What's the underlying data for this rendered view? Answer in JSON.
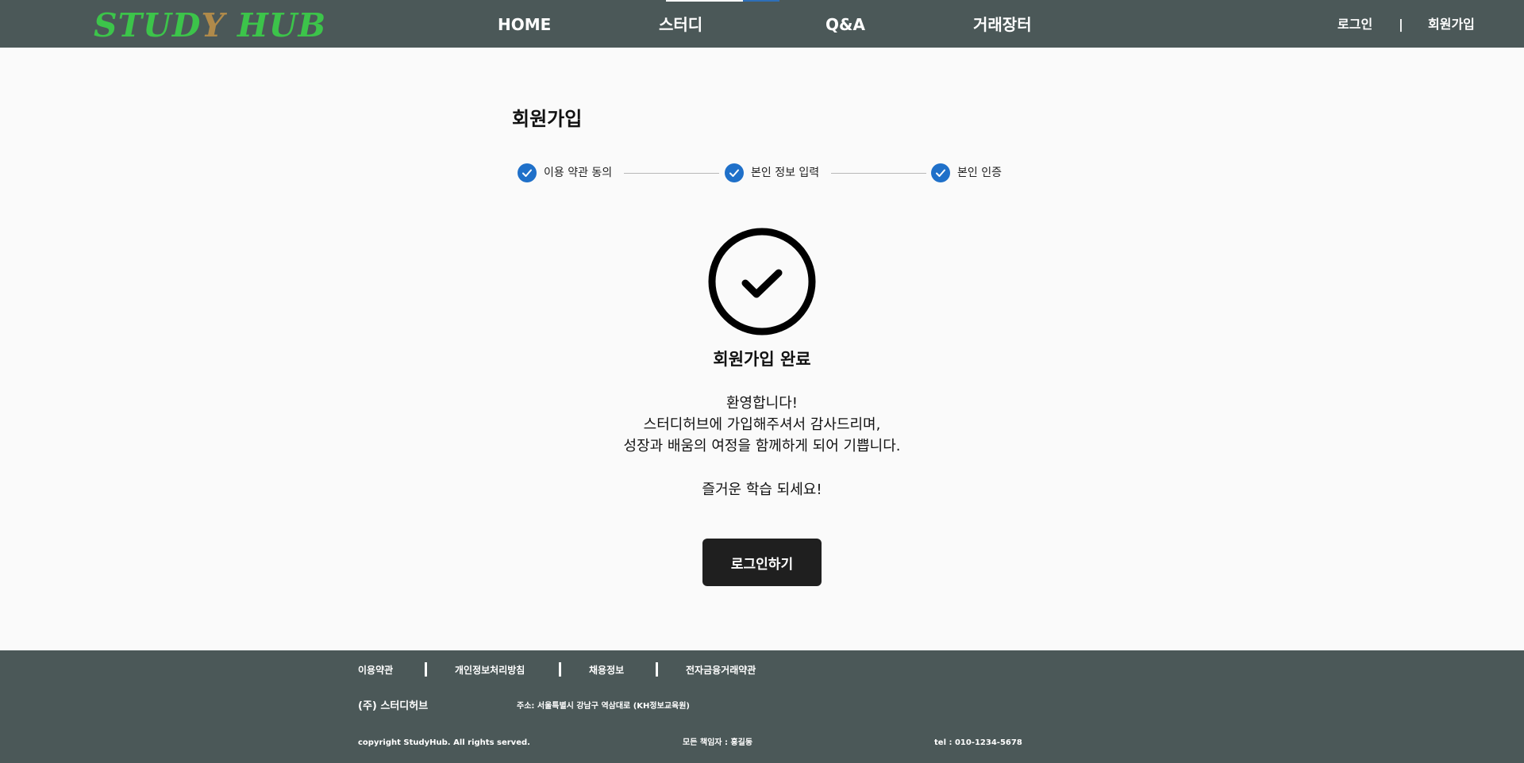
{
  "header": {
    "logo_left": "STUD",
    "logo_y": "Y",
    "logo_right": " HUB",
    "nav": [
      "HOME",
      "스터디",
      "Q&A",
      "거래장터"
    ],
    "login": "로그인",
    "separator": "|",
    "signup": "회원가입"
  },
  "main": {
    "page_title": "회원가입",
    "steps": [
      "이용 약관 동의",
      "본인 정보 입력",
      "본인 인증"
    ],
    "done_title": "회원가입 완료",
    "message_lines": [
      "환영합니다!",
      "스터디허브에 가입해주셔서 감사드리며,",
      "성장과 배움의 여정을 함께하게 되어 기쁩니다.",
      "즐거운 학습 되세요!"
    ],
    "login_button": "로그인하기"
  },
  "footer": {
    "links": [
      "이용약관",
      "개인정보처리방침",
      "채용정보",
      "전자금융거래약관"
    ],
    "company": "(주) 스터디허브",
    "address": "주소: 서울특별시 강남구 역삼대로 (KH정보교육원)",
    "copyright": "copyright StudyHub. All rights served.",
    "manager": "모든 책임자 : 홍길동",
    "tel": "tel : 010-1234-5678"
  },
  "colors": {
    "header_bg": "#4b5858",
    "footer_bg": "#4b5858",
    "logo_green": "#3cc44a",
    "logo_brown": "#b08a4a",
    "step_blue": "#1f70c9",
    "button_bg": "#1f1f1f"
  },
  "icons": [
    "check-circle-icon",
    "step-check-icon"
  ]
}
